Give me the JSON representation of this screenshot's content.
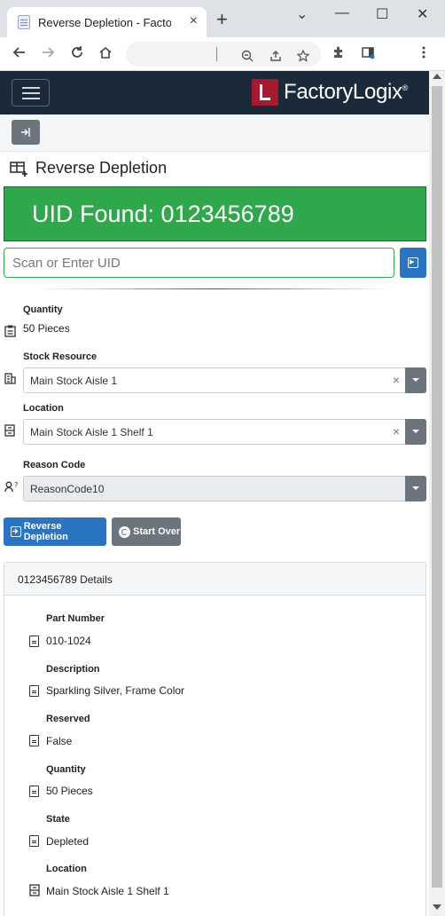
{
  "browser": {
    "tab_title": "Reverse Depletion - FactoryLogix",
    "tab_close": "×",
    "new_tab": "+",
    "minimize": "⌄",
    "window_min": "—",
    "window_max": "☐",
    "window_close": "✕"
  },
  "app": {
    "brand": "FactoryLogix",
    "brand_mark": "®",
    "page_title": "Reverse Depletion",
    "banner_text": "UID Found: 0123456789",
    "scan_placeholder": "Scan or Enter UID"
  },
  "form": {
    "quantity_label": "Quantity",
    "quantity_value": "50 Pieces",
    "stock_resource_label": "Stock Resource",
    "stock_resource_value": "Main Stock Aisle 1",
    "location_label": "Location",
    "location_value": "Main Stock Aisle 1 Shelf 1",
    "reason_code_label": "Reason Code",
    "reason_code_value": "ReasonCode10",
    "clear_glyph": "×"
  },
  "actions": {
    "reverse_depletion_label": "Reverse Depletion",
    "start_over_label": "Start Over"
  },
  "details": {
    "header": "0123456789 Details",
    "fields": [
      {
        "label": "Part Number",
        "value": "010-1024"
      },
      {
        "label": "Description",
        "value": "Sparkling Silver, Frame Color"
      },
      {
        "label": "Reserved",
        "value": "False"
      },
      {
        "label": "Quantity",
        "value": "50 Pieces"
      },
      {
        "label": "State",
        "value": "Depleted"
      },
      {
        "label": "Location",
        "value": "Main Stock Aisle 1 Shelf 1"
      }
    ]
  },
  "colors": {
    "nav_bg": "#1b2a39",
    "brand_red": "#a6192e",
    "success_green": "#2ea84a",
    "primary_blue": "#2a74c4",
    "secondary_gray": "#6c757d"
  },
  "icons": {
    "page": "table-add-icon",
    "quantity": "clipboard-icon",
    "stock_resource": "building-icon",
    "location": "shelf-icon",
    "reason_code": "user-question-icon",
    "detail": "document-icon"
  }
}
